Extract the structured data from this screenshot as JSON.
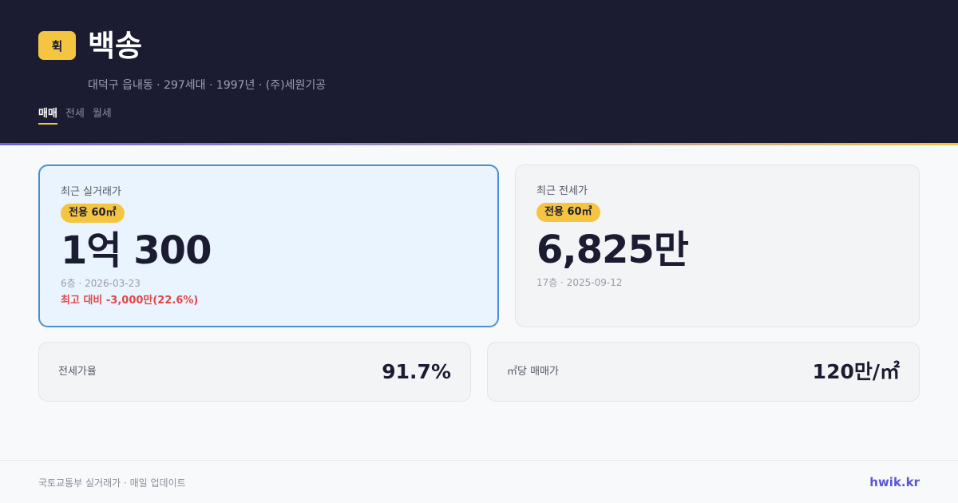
{
  "header": {
    "logo_text": "휙",
    "title": "백송",
    "subtitle": "대덕구 읍내동 · 297세대 · 1997년 · (주)세원기공",
    "tabs": [
      {
        "label": "매매",
        "active": true
      },
      {
        "label": "전세",
        "active": false
      },
      {
        "label": "월세",
        "active": false
      }
    ]
  },
  "sale_card": {
    "label": "최근 실거래가",
    "area": "전용 60㎡",
    "price": "1억 300",
    "meta": "6층 · 2026-03-23",
    "diff": "최고 대비 -3,000만(22.6%)"
  },
  "jeonse_card": {
    "label": "최근 전세가",
    "area": "전용 60㎡",
    "price": "6,825만",
    "meta": "17층 · 2025-09-12"
  },
  "stats": [
    {
      "label": "전세가율",
      "value": "91.7%"
    },
    {
      "label": "㎡당 매매가",
      "value": "120만/㎡"
    }
  ],
  "footer": {
    "source": "국토교통부 실거래가 · 매일 업데이트",
    "brand": "hwik.kr"
  },
  "colors": {
    "header_bg": "#1b1c31",
    "accent_yellow": "#f5c542",
    "accent_blue": "#4a90d0",
    "brand_purple": "#5b55d6",
    "diff_red": "#e04848"
  }
}
